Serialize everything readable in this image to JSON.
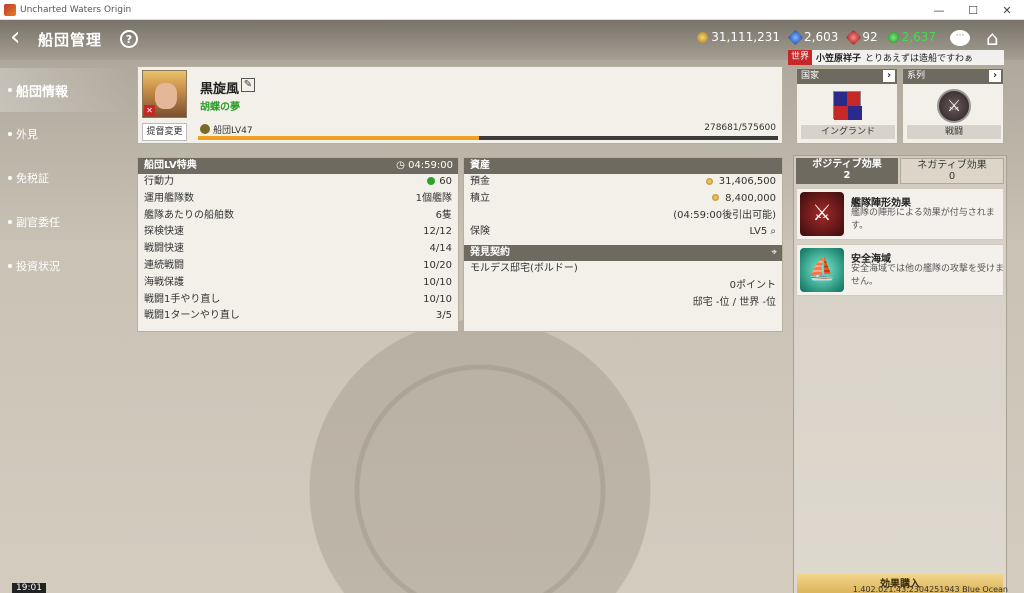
{
  "window": {
    "title": "Uncharted Waters Origin"
  },
  "header": {
    "back": "‹",
    "title": "船団管理",
    "help": "?"
  },
  "currencies": [
    {
      "icon": "gold-coin-icon",
      "value": "31,111,231"
    },
    {
      "icon": "blue-gem-icon",
      "value": "2,603"
    },
    {
      "icon": "red-gem-icon",
      "value": "92"
    },
    {
      "icon": "green-point-icon",
      "value": "2,637"
    }
  ],
  "world_chat": {
    "tag": "世界",
    "name": "小笠原祥子",
    "message": "とりあえずは造船ですわぁ"
  },
  "menu": [
    {
      "label": "船団情報",
      "active": true
    },
    {
      "label": "外見",
      "active": false
    },
    {
      "label": "免税証",
      "active": false
    },
    {
      "label": "副官委任",
      "active": false
    },
    {
      "label": "投資状況",
      "active": false
    }
  ],
  "admiral": {
    "name": "黒旋風",
    "subtitle": "胡蝶の夢",
    "change_label": "提督変更",
    "level_label": "船団LV47",
    "exp_text": "278681/575600",
    "exp_fraction": 0.4842
  },
  "benefits": {
    "title": "船団LV特典",
    "timer": "04:59:00",
    "rows": [
      {
        "label": "行動力",
        "value": "60"
      },
      {
        "label": "運用艦隊数",
        "value": "1個艦隊"
      },
      {
        "label": "艦隊あたりの船舶数",
        "value": "6隻"
      },
      {
        "label": "探検快速",
        "value": "12/12"
      },
      {
        "label": "戦闘快速",
        "value": "4/14"
      },
      {
        "label": "連続戦闘",
        "value": "10/20"
      },
      {
        "label": "海戦保護",
        "value": "10/10"
      },
      {
        "label": "戦闘1手やり直し",
        "value": "10/10"
      },
      {
        "label": "戦闘1ターンやり直し",
        "value": "3/5"
      }
    ]
  },
  "assets": {
    "title": "資産",
    "deposit_label": "預金",
    "deposit_value": "31,406,500",
    "saving_label": "積立",
    "saving_value": "8,400,000",
    "saving_note": "(04:59:00後引出可能)",
    "insurance_label": "保険",
    "insurance_value": "LV5"
  },
  "discovery": {
    "title": "発見契約",
    "place": "モルデス邸宅(ボルドー)",
    "points": "0ポイント",
    "rank": "邸宅 -位 / 世界 -位"
  },
  "country": {
    "head": "国家",
    "label": "イングランド"
  },
  "series": {
    "head": "系列",
    "label": "戦闘"
  },
  "effects": {
    "tab_positive": "ポジティブ効果",
    "tab_positive_count": "2",
    "tab_negative": "ネガティブ効果",
    "tab_negative_count": "0",
    "items": [
      {
        "title": "艦隊陣形効果",
        "desc": "艦隊の陣形による効果が付与されます。"
      },
      {
        "title": "安全海域",
        "desc": "安全海域では他の艦隊の攻撃を受けません。"
      }
    ],
    "buy_label": "効果購入"
  },
  "footer": {
    "clock": "19:01",
    "version": "1.402.021.43.2304251943 Blue Ocean"
  }
}
